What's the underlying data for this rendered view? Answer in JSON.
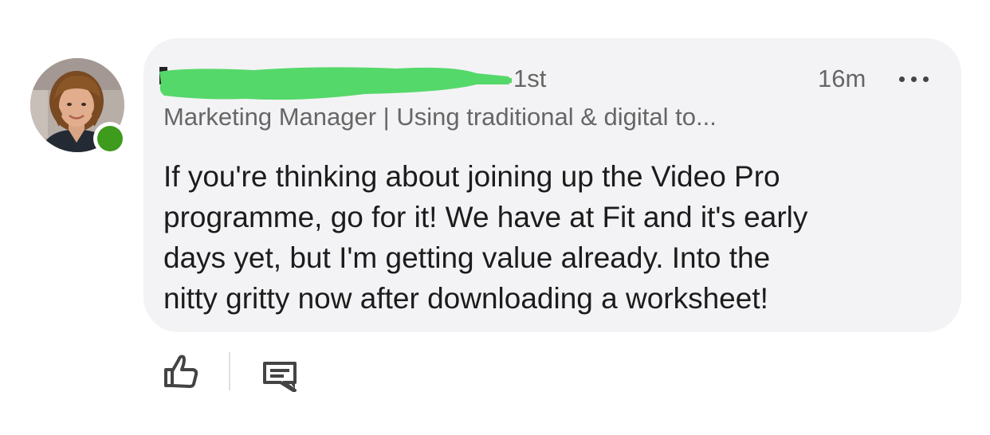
{
  "comment": {
    "author": {
      "connection_degree": "1st",
      "headline": "Marketing Manager | Using traditional & digital to...",
      "online": true,
      "presence_color": "#3e9b1d"
    },
    "timestamp": "16m",
    "text_lines": [
      "If you're thinking about joining up the Video Pro",
      "programme, go for it! We have at Fit and it's early",
      "days yet, but I'm getting value already. Into the",
      "nitty gritty now after downloading a worksheet!"
    ],
    "redaction_color": "#55d86a"
  },
  "icons": {
    "more": "more-options-icon",
    "like": "thumbs-up-icon",
    "comment": "comment-icon"
  }
}
